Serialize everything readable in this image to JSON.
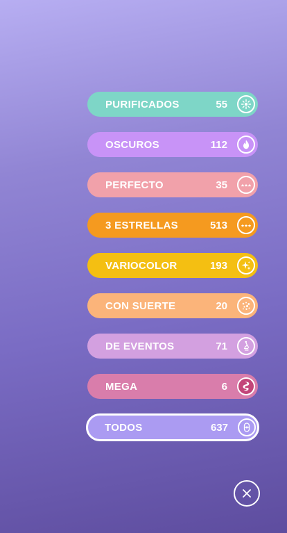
{
  "filters": [
    {
      "label": "PURIFICADOS",
      "count": "55",
      "color": "#7ed6c7",
      "icon": "purified-icon"
    },
    {
      "label": "OSCUROS",
      "count": "112",
      "color": "#c893f7",
      "icon": "shadow-flame-icon"
    },
    {
      "label": "PERFECTO",
      "count": "35",
      "color": "#f1a1aa",
      "icon": "perfect-stars-icon"
    },
    {
      "label": "3 ESTRELLAS",
      "count": "513",
      "color": "#f59a1f",
      "icon": "three-stars-icon"
    },
    {
      "label": "VARIOCOLOR",
      "count": "193",
      "color": "#f4bf12",
      "icon": "shiny-sparkle-icon"
    },
    {
      "label": "CON SUERTE",
      "count": "20",
      "color": "#fbb47a",
      "icon": "lucky-sparkles-icon"
    },
    {
      "label": "DE EVENTOS",
      "count": "71",
      "color": "#d3a0e0",
      "icon": "event-icon"
    },
    {
      "label": "MEGA",
      "count": "6",
      "color": "#d97dab",
      "icon": "mega-icon"
    },
    {
      "label": "TODOS",
      "count": "637",
      "color": "#ab9bf2",
      "icon": "all-pokeball-icon",
      "selected": true
    }
  ],
  "close": {
    "icon": "close-icon"
  }
}
